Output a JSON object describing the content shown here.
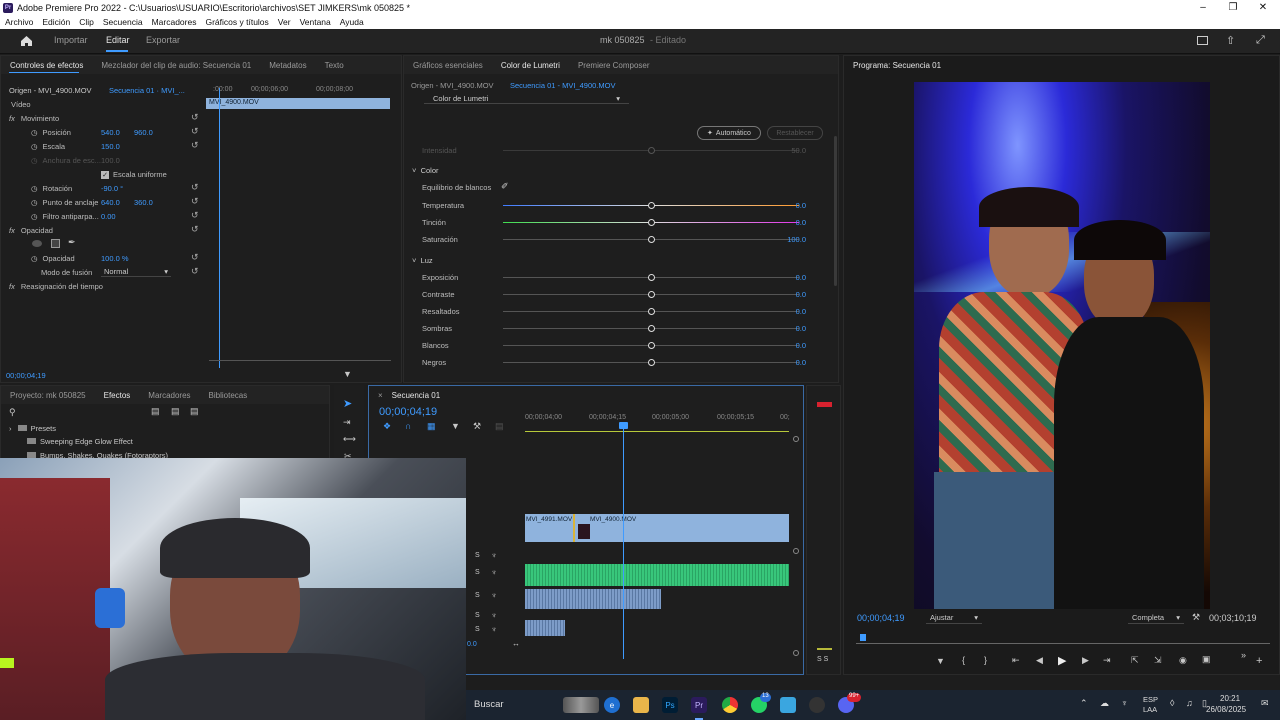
{
  "window": {
    "title": "Adobe Premiere Pro 2022 - C:\\Usuarios\\USUARIO\\Escritorio\\archivos\\SET JIMKERS\\mk 050825 *"
  },
  "menu": [
    "Archivo",
    "Edición",
    "Clip",
    "Secuencia",
    "Marcadores",
    "Gráficos y títulos",
    "Ver",
    "Ventana",
    "Ayuda"
  ],
  "header": {
    "import": "Importar",
    "edit": "Editar",
    "export": "Exportar",
    "project": "mk 050825",
    "status": "- Editado"
  },
  "effect_controls": {
    "tabs": [
      "Controles de efectos",
      "Mezclador del clip de audio: Secuencia 01",
      "Metadatos",
      "Texto"
    ],
    "source": "Origen - MVI_4900.MOV",
    "sequence": "Secuencia 01 · MVI_...",
    "ruler": [
      ":00:00",
      "00;00;06;00",
      "00;00;08;00"
    ],
    "clip": "MVI_4900.MOV",
    "video_label": "Vídeo",
    "motion": "Movimiento",
    "position_label": "Posición",
    "position_x": "540.0",
    "position_y": "960.0",
    "scale_label": "Escala",
    "scale": "150.0",
    "width_label": "Anchura de esc...",
    "width": "100.0",
    "uniform": "Escala uniforme",
    "rotation_label": "Rotación",
    "rotation": "-90.0 °",
    "anchor_label": "Punto de anclaje",
    "anchor_x": "640.0",
    "anchor_y": "360.0",
    "flicker_label": "Filtro antiparpa...",
    "flicker": "0.00",
    "opacity_section": "Opacidad",
    "opacity_label": "Opacidad",
    "opacity": "100.0 %",
    "blend_label": "Modo de fusión",
    "blend": "Normal",
    "time_remap": "Reasignación del tiempo",
    "timecode": "00;00;04;19"
  },
  "lumetri": {
    "tabs": [
      "Gráficos esenciales",
      "Color de Lumetri",
      "Premiere Composer"
    ],
    "source": "Origen - MVI_4900.MOV",
    "sequence": "Secuencia 01 - MVI_4900.MOV",
    "effect": "Color de Lumetri",
    "auto": "Automático",
    "reset": "Restablecer",
    "intensity_label": "Intensidad",
    "intensity": "50.0",
    "color_section": "Color",
    "wb": "Equilibrio de blancos",
    "rows1": [
      {
        "label": "Temperatura",
        "value": "0.0"
      },
      {
        "label": "Tinción",
        "value": "0.0"
      },
      {
        "label": "Saturación",
        "value": "100.0"
      }
    ],
    "light_section": "Luz",
    "rows2": [
      {
        "label": "Exposición",
        "value": "0.0"
      },
      {
        "label": "Contraste",
        "value": "0.0"
      },
      {
        "label": "Resaltados",
        "value": "0.0"
      },
      {
        "label": "Sombras",
        "value": "0.0"
      },
      {
        "label": "Blancos",
        "value": "0.0"
      },
      {
        "label": "Negros",
        "value": "0.0"
      }
    ]
  },
  "program": {
    "tab": "Programa: Secuencia 01",
    "timecode": "00;00;04;19",
    "fit": "Ajustar",
    "quality": "Completa",
    "duration": "00;03;10;19"
  },
  "project": {
    "tabs": [
      "Proyecto: mk 050825",
      "Efectos",
      "Marcadores",
      "Bibliotecas"
    ],
    "items": [
      "Presets",
      "Sweeping Edge Glow Effect",
      "Bumps, Shakes, Quakes (Fotoraptors)"
    ]
  },
  "timeline": {
    "tab": "Secuencia 01",
    "timecode": "00;00;04;19",
    "ruler": [
      "00;00;04;00",
      "00;00;04;15",
      "00;00;05;00",
      "00;00;05;15",
      "00;"
    ],
    "clip1": "MVI_4991.MOV",
    "clip2": "MVI_4900.MOV",
    "track_s": "S",
    "zero": "0.0"
  },
  "meter": {
    "label": "S S"
  },
  "taskbar": {
    "search": "Buscar",
    "lang1": "ESP",
    "lang2": "LAA",
    "time": "20:21",
    "date": "26/08/2025",
    "ps": "Ps",
    "pr": "Pr",
    "badge1": "13",
    "badge2": "99+"
  }
}
